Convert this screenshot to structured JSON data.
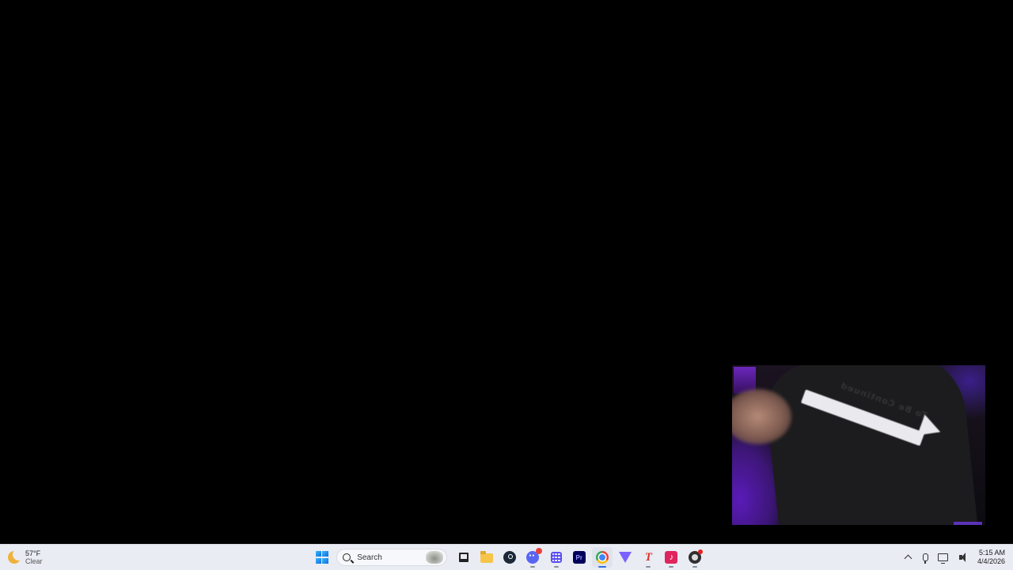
{
  "weather": {
    "temperature": "57°F",
    "condition": "Clear",
    "icon": "moon-icon"
  },
  "taskbar": {
    "search": {
      "label": "Search"
    },
    "apps": [
      {
        "name": "start",
        "icon": "windows-logo-icon"
      },
      {
        "name": "task-view",
        "icon": "task-view-icon"
      },
      {
        "name": "file-explorer",
        "icon": "folder-icon"
      },
      {
        "name": "steam",
        "icon": "steam-icon"
      },
      {
        "name": "discord",
        "icon": "discord-icon"
      },
      {
        "name": "app-grid",
        "icon": "grid-icon"
      },
      {
        "name": "premiere-pro",
        "icon": "pr-icon",
        "text": "Pr"
      },
      {
        "name": "chrome",
        "icon": "chrome-icon"
      },
      {
        "name": "vpn",
        "icon": "vpn-icon"
      },
      {
        "name": "t-app",
        "icon": "t-icon",
        "text": "T"
      },
      {
        "name": "tiktok",
        "icon": "tiktok-icon"
      },
      {
        "name": "obs",
        "icon": "obs-icon"
      }
    ],
    "accent_color": "#2f6fe0"
  },
  "tray": {
    "time": "5:15 AM",
    "date": "4/4/2026"
  },
  "webcam": {
    "shirt_text": "To Be Continued"
  }
}
